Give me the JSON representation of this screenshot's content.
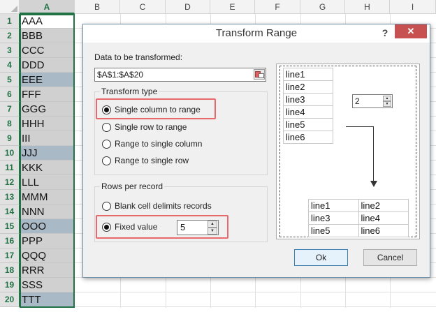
{
  "sheet": {
    "columns": [
      "A",
      "B",
      "C",
      "D",
      "E",
      "F",
      "G",
      "H",
      "I"
    ],
    "rows": [
      {
        "num": "1",
        "value": "AAA",
        "style": "first"
      },
      {
        "num": "2",
        "value": "BBB",
        "style": "gray"
      },
      {
        "num": "3",
        "value": "CCC",
        "style": "gray"
      },
      {
        "num": "4",
        "value": "DDD",
        "style": "gray"
      },
      {
        "num": "5",
        "value": "EEE",
        "style": "blue"
      },
      {
        "num": "6",
        "value": "FFF",
        "style": "gray"
      },
      {
        "num": "7",
        "value": "GGG",
        "style": "gray"
      },
      {
        "num": "8",
        "value": "HHH",
        "style": "gray"
      },
      {
        "num": "9",
        "value": "III",
        "style": "gray"
      },
      {
        "num": "10",
        "value": "JJJ",
        "style": "blue"
      },
      {
        "num": "11",
        "value": "KKK",
        "style": "gray"
      },
      {
        "num": "12",
        "value": "LLL",
        "style": "gray"
      },
      {
        "num": "13",
        "value": "MMM",
        "style": "gray"
      },
      {
        "num": "14",
        "value": "NNN",
        "style": "gray"
      },
      {
        "num": "15",
        "value": "OOO",
        "style": "blue"
      },
      {
        "num": "16",
        "value": "PPP",
        "style": "gray"
      },
      {
        "num": "17",
        "value": "QQQ",
        "style": "gray"
      },
      {
        "num": "18",
        "value": "RRR",
        "style": "gray"
      },
      {
        "num": "19",
        "value": "SSS",
        "style": "gray"
      },
      {
        "num": "20",
        "value": "TTT",
        "style": "blue"
      }
    ]
  },
  "dialog": {
    "title": "Transform Range",
    "help": "?",
    "close": "✕",
    "data_label": "Data to be transformed:",
    "range_value": "$A$1:$A$20",
    "transform_type": {
      "title": "Transform type",
      "options": [
        {
          "label": "Single column to range",
          "checked": true
        },
        {
          "label": "Single row to range",
          "checked": false
        },
        {
          "label": "Range to single column",
          "checked": false
        },
        {
          "label": "Range to single row",
          "checked": false
        }
      ]
    },
    "rows_per_record": {
      "title": "Rows per record",
      "blank_label": "Blank cell delimits records",
      "fixed_label": "Fixed value",
      "fixed_value": "5"
    },
    "preview": {
      "source": [
        "line1",
        "line2",
        "line3",
        "line4",
        "line5",
        "line6"
      ],
      "spin_value": "2",
      "result": [
        [
          "line1",
          "line2"
        ],
        [
          "line3",
          "line4"
        ],
        [
          "line5",
          "line6"
        ]
      ]
    },
    "ok": "Ok",
    "cancel": "Cancel"
  },
  "colors": {
    "excel_green": "#217346",
    "highlight_red": "#e8696b",
    "close_red": "#c75050",
    "blue_cell": "#aab9c6"
  }
}
